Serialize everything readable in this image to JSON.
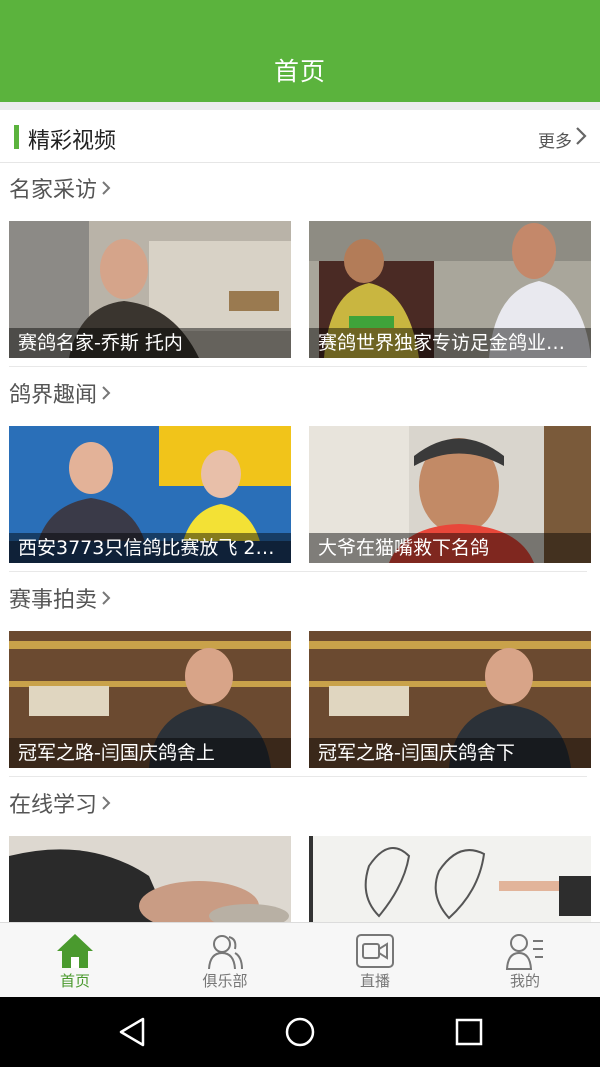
{
  "header": {
    "title": "首页"
  },
  "section": {
    "title": "精彩视频",
    "more_label": "更多"
  },
  "categories": [
    {
      "title": "名家采访",
      "videos": [
        {
          "caption": "赛鸽名家-乔斯 托内"
        },
        {
          "caption": "赛鸽世界独家专访足金鸽业…"
        }
      ]
    },
    {
      "title": "鸽界趣闻",
      "videos": [
        {
          "caption": "西安3773只信鸽比赛放飞 24…"
        },
        {
          "caption": "大爷在猫嘴救下名鸽"
        }
      ]
    },
    {
      "title": "赛事拍卖",
      "videos": [
        {
          "caption": "冠军之路-闫国庆鸽舍上"
        },
        {
          "caption": "冠军之路-闫国庆鸽舍下"
        }
      ]
    },
    {
      "title": "在线学习",
      "videos": [
        {
          "caption": ""
        },
        {
          "caption": ""
        }
      ]
    }
  ],
  "tabs": [
    {
      "label": "首页",
      "icon": "home-icon",
      "active": true
    },
    {
      "label": "俱乐部",
      "icon": "people-icon",
      "active": false
    },
    {
      "label": "直播",
      "icon": "video-camera-icon",
      "active": false
    },
    {
      "label": "我的",
      "icon": "profile-icon",
      "active": false
    }
  ],
  "system_nav": {
    "icons": [
      "back-icon",
      "home-circle-icon",
      "recents-icon"
    ]
  },
  "colors": {
    "brand_green": "#5bb33d",
    "active_tab": "#4a9a2e"
  }
}
